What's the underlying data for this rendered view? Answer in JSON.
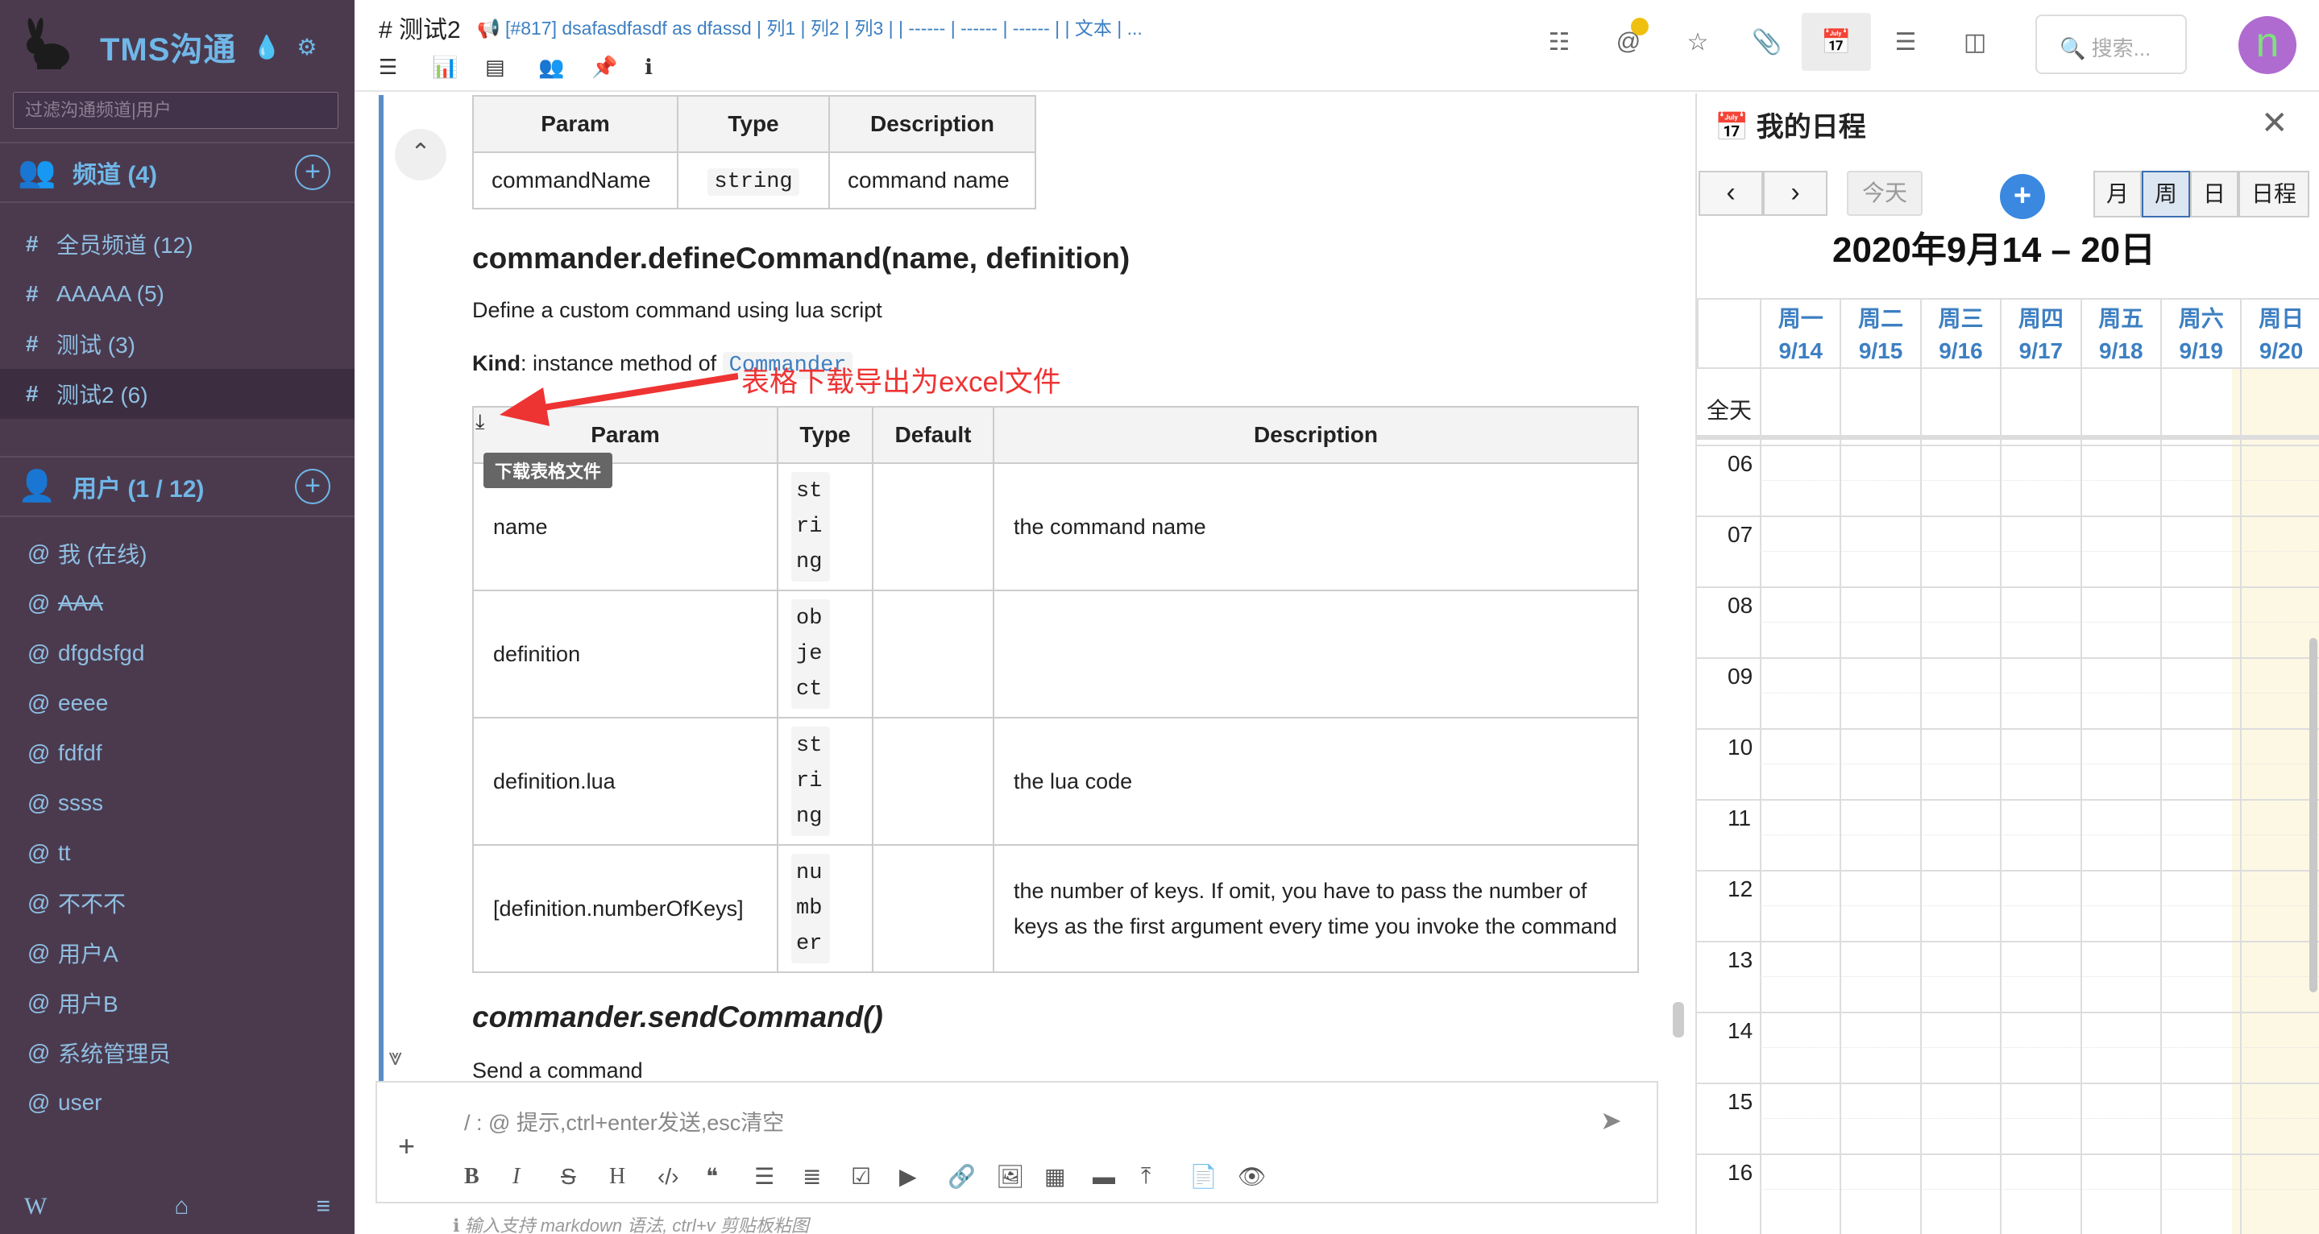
{
  "sidebar": {
    "brand": "TMS沟通",
    "filter_placeholder": "过滤沟通频道|用户",
    "channels_header": "频道 (4)",
    "channels": [
      {
        "label": "全员频道 (12)"
      },
      {
        "label": "AAAAA (5)"
      },
      {
        "label": "测试 (3)"
      },
      {
        "label": "测试2 (6)"
      }
    ],
    "users_header": "用户 (1 / 12)",
    "users": [
      {
        "label": "我 (在线)"
      },
      {
        "label": "AAA"
      },
      {
        "label": "dfgdsfgd"
      },
      {
        "label": "eeee"
      },
      {
        "label": "fdfdf"
      },
      {
        "label": "ssss"
      },
      {
        "label": "tt"
      },
      {
        "label": "不不不"
      },
      {
        "label": "用户A"
      },
      {
        "label": "用户B"
      },
      {
        "label": "系统管理员"
      },
      {
        "label": "user"
      }
    ],
    "bottom_left": "W"
  },
  "header": {
    "title": "# 测试2",
    "desc": "[#817] dsafasdfasdf as dfassd | 列1 | 列2 | 列3 | | ------ | ------ | ------ | | 文本 | ...",
    "search_placeholder": "搜索...",
    "avatar_letter": "n"
  },
  "content": {
    "t1_headers": [
      "Param",
      "Type",
      "Description"
    ],
    "t1_row": [
      "commandName",
      "string",
      "command name"
    ],
    "h3": "commander.defineCommand(name, definition)",
    "p1": "Define a custom command using lua script",
    "kind_label": "Kind",
    "kind_text": ": instance method of ",
    "kind_code": "Commander",
    "annotation": "表格下载导出为excel文件",
    "tooltip": "下载表格文件",
    "t2_headers": [
      "Param",
      "Type",
      "Default",
      "Description"
    ],
    "t2_rows": [
      {
        "param": "name",
        "type": "string",
        "def": "",
        "desc": "the command name"
      },
      {
        "param": "definition",
        "type": "object",
        "def": "",
        "desc": ""
      },
      {
        "param": "definition.lua",
        "type": "string",
        "def": "",
        "desc": "the lua code"
      },
      {
        "param": "[definition.numberOfKeys]",
        "type": "number",
        "def": "",
        "desc": "the number of keys. If omit, you have to pass the number of keys as the first argument every time you invoke the command"
      }
    ],
    "h3b": "commander.sendCommand()",
    "p3": "Send a command"
  },
  "composer": {
    "placeholder": "/ : @ 提示,ctrl+enter发送,esc清空",
    "hint": "输入支持 markdown 语法, ctrl+v 剪贴板粘图"
  },
  "calendar": {
    "title": "我的日程",
    "today": "今天",
    "views": [
      "月",
      "周",
      "日",
      "日程"
    ],
    "range": "2020年9月14 – 20日",
    "days": [
      {
        "d": "周一",
        "n": "9/14"
      },
      {
        "d": "周二",
        "n": "9/15"
      },
      {
        "d": "周三",
        "n": "9/16"
      },
      {
        "d": "周四",
        "n": "9/17"
      },
      {
        "d": "周五",
        "n": "9/18"
      },
      {
        "d": "周六",
        "n": "9/19"
      },
      {
        "d": "周日",
        "n": "9/20"
      }
    ],
    "allday": "全天",
    "hours": [
      "06",
      "07",
      "08",
      "09",
      "10",
      "11",
      "12",
      "13",
      "14",
      "15",
      "16"
    ]
  }
}
